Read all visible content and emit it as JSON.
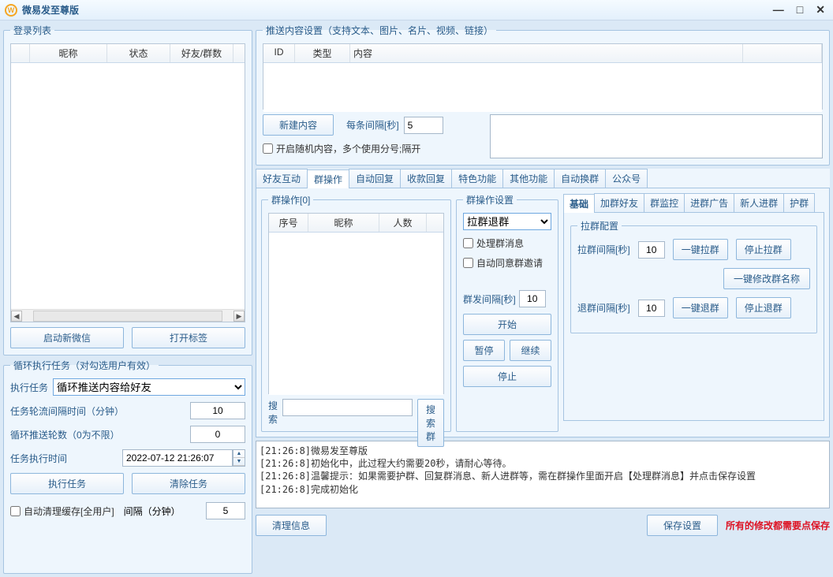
{
  "title": "微易发至尊版",
  "login_panel": {
    "legend": "登录列表",
    "cols": [
      "",
      "昵称",
      "状态",
      "好友/群数"
    ],
    "btn_new": "启动新微信",
    "btn_tag": "打开标签"
  },
  "loop_panel": {
    "legend": "循环执行任务（对勾选用户有效）",
    "task_label": "执行任务",
    "task_value": "循环推送内容给好友",
    "interval_label": "任务轮流间隔时间（分钟）",
    "interval_value": "10",
    "rounds_label": "循环推送轮数（0为不限）",
    "rounds_value": "0",
    "time_label": "任务执行时间",
    "time_value": "2022-07-12 21:26:07",
    "btn_exec": "执行任务",
    "btn_clear": "清除任务",
    "auto_clean": "自动清理缓存[全用户]",
    "clean_int_label": "间隔（分钟）",
    "clean_int_value": "5"
  },
  "push_panel": {
    "legend": "推送内容设置（支持文本、图片、名片、视频、链接）",
    "cols": [
      "ID",
      "类型",
      "内容",
      ""
    ],
    "btn_new": "新建内容",
    "interval_label": "每条间隔[秒]",
    "interval_value": "5",
    "random_cb": "开启随机内容，多个使用分号;隔开"
  },
  "tabs": [
    "好友互动",
    "群操作",
    "自动回复",
    "收款回复",
    "特色功能",
    "其他功能",
    "自动换群",
    "公众号"
  ],
  "group_ops": {
    "legend": "群操作[0]",
    "cols": [
      "序号",
      "昵称",
      "人数"
    ],
    "search_label": "搜索",
    "search_btn": "搜索群"
  },
  "group_set": {
    "legend": "群操作设置",
    "mode": "拉群退群",
    "cb_handle": "处理群消息",
    "cb_auto": "自动同意群邀请",
    "send_int_label": "群发间隔[秒]",
    "send_int_value": "10",
    "btn_start": "开始",
    "btn_pause": "暂停",
    "btn_cont": "继续",
    "btn_stop": "停止"
  },
  "subtabs": [
    "基础",
    "加群好友",
    "群监控",
    "进群广告",
    "新人进群",
    "护群"
  ],
  "pull_cfg": {
    "legend": "拉群配置",
    "pull_int_label": "拉群间隔[秒]",
    "pull_int_value": "10",
    "btn_pull": "一键拉群",
    "btn_stop_pull": "停止拉群",
    "btn_rename": "一键修改群名称",
    "quit_int_label": "退群间隔[秒]",
    "quit_int_value": "10",
    "btn_quit": "一键退群",
    "btn_stop_quit": "停止退群"
  },
  "log": [
    "[21:26:8]微易发至尊版",
    "[21:26:8]初始化中，此过程大约需要20秒，请耐心等待。",
    "[21:26:8]温馨提示：如果需要护群、回复群消息、新人进群等，需在群操作里面开启【处理群消息】并点击保存设置",
    "[21:26:8]完成初始化"
  ],
  "bottom": {
    "btn_clear": "清理信息",
    "btn_save": "保存设置",
    "warn": "所有的修改都需要点保存"
  }
}
